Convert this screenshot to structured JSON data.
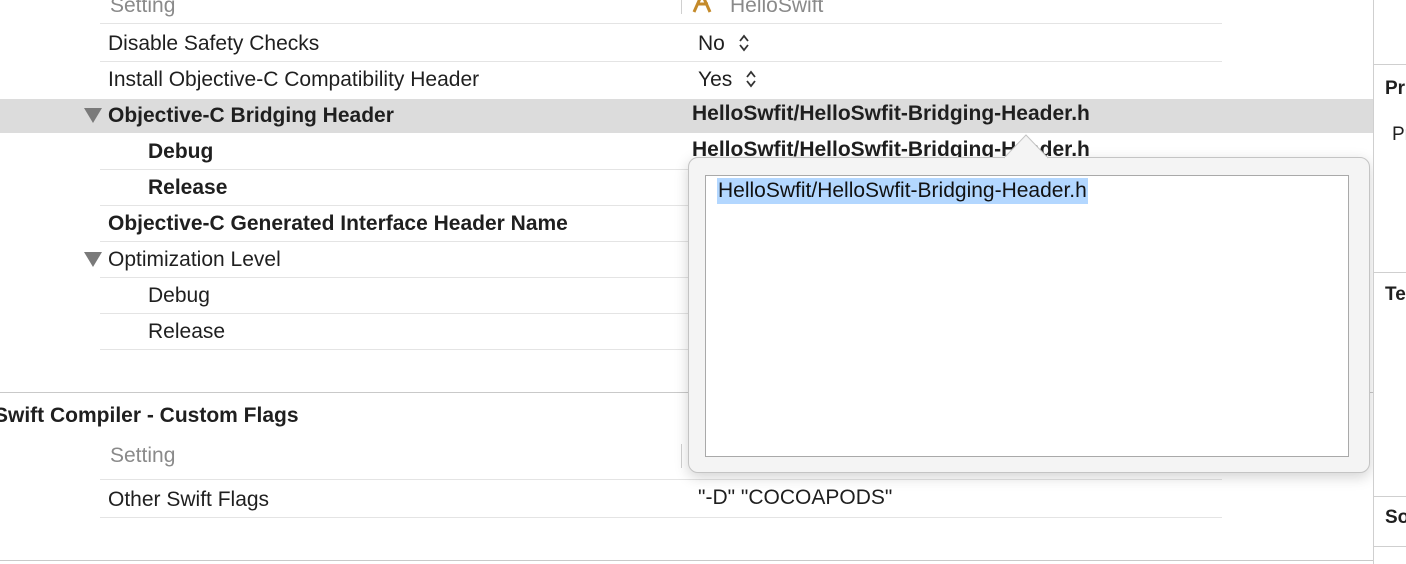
{
  "build_settings": {
    "top_header": {
      "setting": "Setting",
      "target": "HelloSwift"
    },
    "rows": [
      {
        "label": "Disable Safety Checks",
        "value": "No"
      },
      {
        "label": "Install Objective-C Compatibility Header",
        "value": "Yes"
      },
      {
        "label": "Objective-C Bridging Header",
        "value": "HelloSwfit/HelloSwfit-Bridging-Header.h"
      },
      {
        "label": "Debug",
        "value": "HelloSwfit/HelloSwfit-Bridging-Header.h"
      },
      {
        "label": "Release",
        "value": ""
      },
      {
        "label": "Objective-C Generated Interface Header Name",
        "value": ""
      },
      {
        "label": "Optimization Level",
        "value": ""
      },
      {
        "label": "Debug",
        "value": ""
      },
      {
        "label": "Release",
        "value": ""
      }
    ],
    "custom_flags_section": {
      "title": "Swift Compiler - Custom Flags",
      "setting_header": "Setting",
      "rows": [
        {
          "label": "Other Swift Flags",
          "value": "\"-D\" \"COCOAPODS\""
        }
      ]
    }
  },
  "popover": {
    "text": "HelloSwfit/HelloSwfit-Bridging-Header.h"
  },
  "inspector": {
    "labels": [
      "Pr",
      "Pr",
      "Te",
      "So"
    ]
  },
  "colors": {
    "selected_row": "#dcdcdc",
    "text_selection": "#b3d7ff",
    "popover_background": "#f4f4f4"
  }
}
